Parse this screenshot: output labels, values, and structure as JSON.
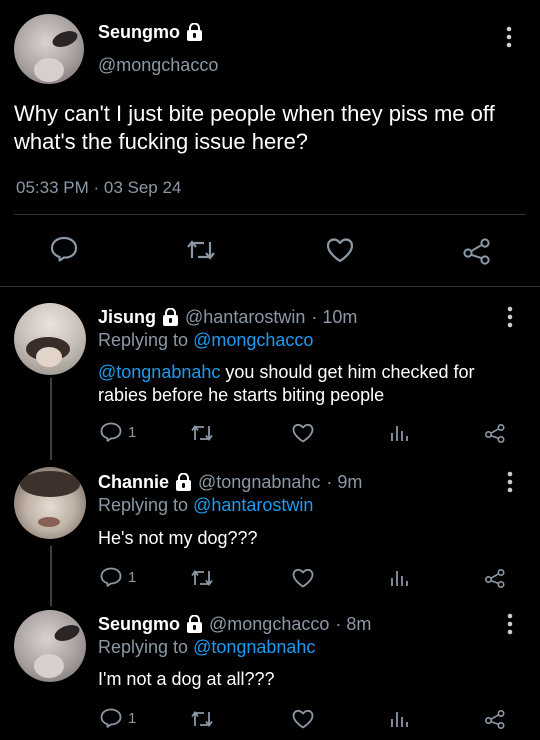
{
  "main_tweet": {
    "display_name": "Seungmo",
    "handle": "@mongchacco",
    "text": "Why can't I just bite people when they piss me off what's the fucking issue here?",
    "timestamp": "05:33 PM · 03 Sep 24",
    "icons": [
      "lock-icon",
      "more-icon",
      "reply-icon",
      "retweet-icon",
      "like-icon",
      "share-icon"
    ]
  },
  "replies": [
    {
      "display_name": "Jisung",
      "handle": "@hantarostwin",
      "time": "· 10m",
      "replying_prefix": "Replying to ",
      "replying_to": "@mongchacco",
      "mention": "@tongnabnahc",
      "text": " you should get him checked for rabies before he starts biting people",
      "reply_count": "1"
    },
    {
      "display_name": "Channie",
      "handle": "@tongnabnahc",
      "time": "· 9m",
      "replying_prefix": "Replying to ",
      "replying_to": "@hantarostwin",
      "text": "He's not my dog???",
      "reply_count": "1"
    },
    {
      "display_name": "Seungmo",
      "handle": "@mongchacco",
      "time": "· 8m",
      "replying_prefix": "Replying to ",
      "replying_to": "@tongnabnahc",
      "text": "I'm not a dog at all???",
      "reply_count": "1"
    }
  ],
  "colors": {
    "background": "#000000",
    "link": "#1d9bf0",
    "muted": "#8b98a5"
  }
}
